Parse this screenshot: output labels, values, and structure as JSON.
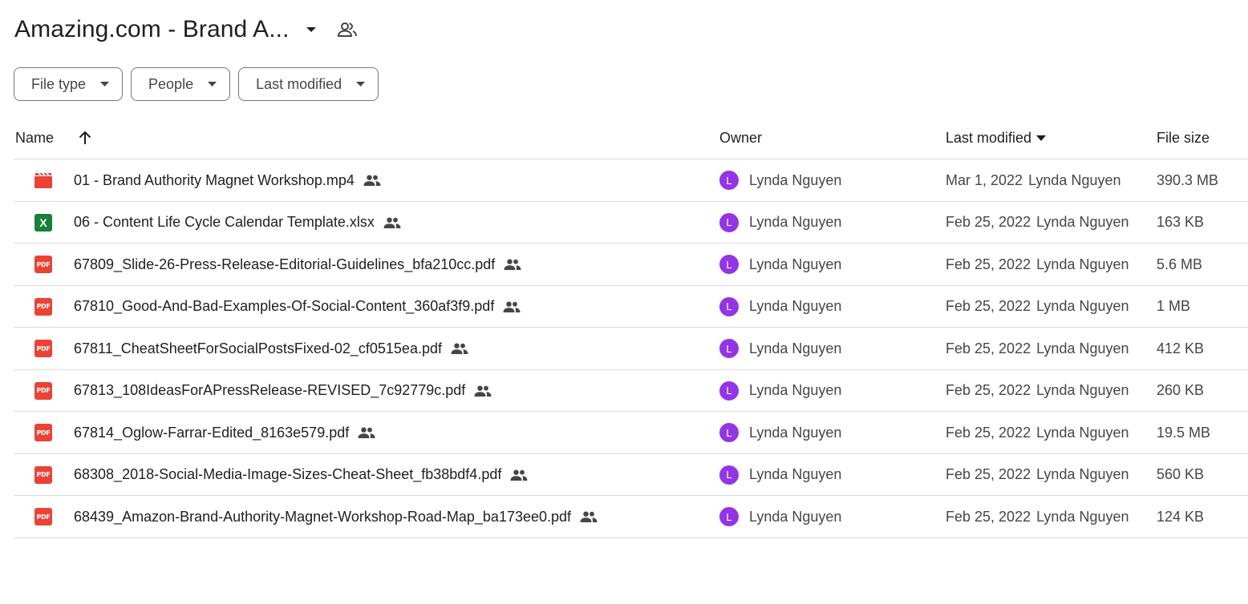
{
  "header": {
    "folder_title": "Amazing.com - Brand A...",
    "caret_icon": "arrow-drop-down-icon",
    "share_icon": "people-outline-icon"
  },
  "filters": [
    {
      "label": "File type"
    },
    {
      "label": "People"
    },
    {
      "label": "Last modified"
    }
  ],
  "columns": {
    "name": "Name",
    "owner": "Owner",
    "last_modified": "Last modified",
    "file_size": "File size"
  },
  "colors": {
    "pdf": "#ea4335",
    "xlsx": "#188038",
    "video": "#ea4335",
    "avatar": "#9334e6"
  },
  "files": [
    {
      "type": "video",
      "icon_text": "",
      "name": "01 - Brand Authority Magnet Workshop.mp4",
      "owner_initial": "L",
      "owner": "Lynda Nguyen",
      "modified_date": "Mar 1, 2022",
      "modified_by": "Lynda Nguyen",
      "size": "390.3 MB"
    },
    {
      "type": "xlsx",
      "icon_text": "X",
      "name": "06 - Content Life Cycle Calendar Template.xlsx",
      "owner_initial": "L",
      "owner": "Lynda Nguyen",
      "modified_date": "Feb 25, 2022",
      "modified_by": "Lynda Nguyen",
      "size": "163 KB"
    },
    {
      "type": "pdf",
      "icon_text": "PDF",
      "name": "67809_Slide-26-Press-Release-Editorial-Guidelines_bfa210cc.pdf",
      "owner_initial": "L",
      "owner": "Lynda Nguyen",
      "modified_date": "Feb 25, 2022",
      "modified_by": "Lynda Nguyen",
      "size": "5.6 MB"
    },
    {
      "type": "pdf",
      "icon_text": "PDF",
      "name": "67810_Good-And-Bad-Examples-Of-Social-Content_360af3f9.pdf",
      "owner_initial": "L",
      "owner": "Lynda Nguyen",
      "modified_date": "Feb 25, 2022",
      "modified_by": "Lynda Nguyen",
      "size": "1 MB"
    },
    {
      "type": "pdf",
      "icon_text": "PDF",
      "name": "67811_CheatSheetForSocialPostsFixed-02_cf0515ea.pdf",
      "owner_initial": "L",
      "owner": "Lynda Nguyen",
      "modified_date": "Feb 25, 2022",
      "modified_by": "Lynda Nguyen",
      "size": "412 KB"
    },
    {
      "type": "pdf",
      "icon_text": "PDF",
      "name": "67813_108IdeasForAPressRelease-REVISED_7c92779c.pdf",
      "owner_initial": "L",
      "owner": "Lynda Nguyen",
      "modified_date": "Feb 25, 2022",
      "modified_by": "Lynda Nguyen",
      "size": "260 KB"
    },
    {
      "type": "pdf",
      "icon_text": "PDF",
      "name": "67814_Oglow-Farrar-Edited_8163e579.pdf",
      "owner_initial": "L",
      "owner": "Lynda Nguyen",
      "modified_date": "Feb 25, 2022",
      "modified_by": "Lynda Nguyen",
      "size": "19.5 MB"
    },
    {
      "type": "pdf",
      "icon_text": "PDF",
      "name": "68308_2018-Social-Media-Image-Sizes-Cheat-Sheet_fb38bdf4.pdf",
      "owner_initial": "L",
      "owner": "Lynda Nguyen",
      "modified_date": "Feb 25, 2022",
      "modified_by": "Lynda Nguyen",
      "size": "560 KB"
    },
    {
      "type": "pdf",
      "icon_text": "PDF",
      "name": "68439_Amazon-Brand-Authority-Magnet-Workshop-Road-Map_ba173ee0.pdf",
      "owner_initial": "L",
      "owner": "Lynda Nguyen",
      "modified_date": "Feb 25, 2022",
      "modified_by": "Lynda Nguyen",
      "size": "124 KB"
    }
  ]
}
